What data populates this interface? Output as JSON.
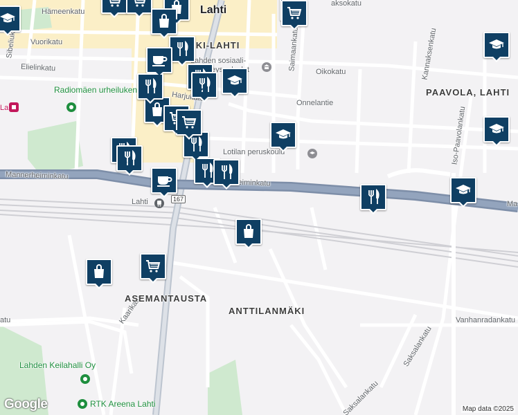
{
  "map": {
    "streets": {
      "hameenkatu": "Hämeenkatu",
      "vuorikatu": "Vuorikatu",
      "elielinkatu": "Elielinkatu",
      "sibeliuksenkatu": "Sibeliuksenkatu",
      "harjukatu": "Harjukatu",
      "mannerheiminkatu_w": "Mannerheiminkatu",
      "mannerheiminkatu_e": "Mannerheiminkatu",
      "mannerheiminkatu_edge": "Ma",
      "saimaankatu": "Saimaankatu",
      "oikokatu": "Oikokatu",
      "onnelantie": "Onnelantie",
      "kannaksenkatu": "Kannaksenkatu",
      "iso_paavolankatu": "Iso-Paavolankatu",
      "kaarikatu": "Kaarikatu",
      "vanhanradankatu": "Vanhanradankatu",
      "saksalankatu_1": "Saksalankatu",
      "saksalankatu_2": "Saksalankatu",
      "aksokatu": "aksokatu",
      "katu_left": "atu"
    },
    "areas": {
      "lahti": "Lahti",
      "keski_lahti": "KESKI-LAHTI",
      "paavola": "PAAVOLA, LAHTI",
      "asemantausta": "ASEMANTAUSTA",
      "anttilanmaki": "ANTTILANMÄKI"
    },
    "pois": {
      "radiomaki": "Radiomäen urheilukenttä",
      "sosiaali": "Lahden sosiaali- ja terveyspalvelut",
      "lotila": "Lotilan peruskoulu",
      "lahti_station": "Lahti",
      "keilahalli": "Lahden Keilahalli Oy",
      "rtk": "RTK Areena Lahti",
      "left_edge": "La"
    },
    "road_shield": "167",
    "attribution": "Map data ©2025",
    "logo": "Google"
  },
  "markers": [
    {
      "icon": "cart-icon"
    },
    {
      "icon": "cart-icon"
    },
    {
      "icon": "bag-icon"
    },
    {
      "icon": "cap-icon"
    },
    {
      "icon": "bag-icon"
    },
    {
      "icon": "bag-icon"
    },
    {
      "icon": "cart-icon"
    },
    {
      "icon": "fork-knife-icon"
    },
    {
      "icon": "cup-icon"
    },
    {
      "icon": "fork-knife-icon"
    },
    {
      "icon": "cap-icon"
    },
    {
      "icon": "fork-knife-icon"
    },
    {
      "icon": "bag-icon"
    },
    {
      "icon": "fork-knife-icon"
    },
    {
      "icon": "cart-icon"
    },
    {
      "icon": "fork-knife-icon"
    },
    {
      "icon": "cap-icon"
    },
    {
      "icon": "cap-icon"
    },
    {
      "icon": "fork-knife-icon"
    },
    {
      "icon": "fork-knife-icon"
    },
    {
      "icon": "fork-knife-icon"
    },
    {
      "icon": "fork-knife-icon"
    },
    {
      "icon": "cup-icon"
    },
    {
      "icon": "fork-knife-icon"
    },
    {
      "icon": "cap-icon"
    },
    {
      "icon": "bag-icon"
    },
    {
      "icon": "cart-icon"
    },
    {
      "icon": "bag-icon"
    },
    {
      "icon": "cap-icon"
    },
    {
      "icon": "cart-icon"
    }
  ],
  "colors": {
    "marker": "#0f3f63",
    "highway": "#8d9fb8",
    "park": "#cfe9cf",
    "downtown": "#fbefc7"
  }
}
